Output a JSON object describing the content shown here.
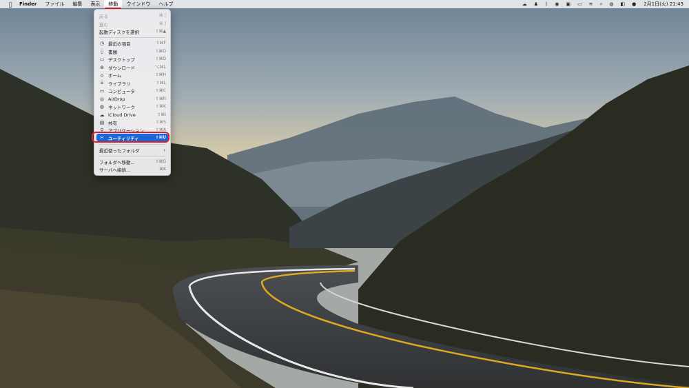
{
  "menubar": {
    "apple_icon": "apple-icon",
    "app_name": "Finder",
    "items": [
      "ファイル",
      "編集",
      "表示",
      "移動",
      "ウインドウ",
      "ヘルプ"
    ],
    "active_item": "移動",
    "status_icons": [
      "cloud-icon",
      "person-icon",
      "bluetooth-icon",
      "record-icon",
      "keyboard-icon",
      "wifi-icon",
      "search-icon",
      "user-icon",
      "control-center-icon",
      "siri-icon"
    ],
    "clock": "2月1日(火) 21:43"
  },
  "go_menu": {
    "items": [
      {
        "label": "戻る",
        "shortcut": "⌘ [",
        "disabled": true
      },
      {
        "label": "進む",
        "shortcut": "⌘ ]",
        "disabled": true
      },
      {
        "label": "起動ディスクを選択",
        "shortcut": "⇧⌘▲"
      },
      {
        "label": "最近の項目",
        "shortcut": "⇧⌘F",
        "icon": "clock-icon"
      },
      {
        "label": "書類",
        "shortcut": "⇧⌘O",
        "icon": "document-icon"
      },
      {
        "label": "デスクトップ",
        "shortcut": "⇧⌘D",
        "icon": "desktop-icon"
      },
      {
        "label": "ダウンロード",
        "shortcut": "⌥⌘L",
        "icon": "download-icon"
      },
      {
        "label": "ホーム",
        "shortcut": "⇧⌘H",
        "icon": "home-icon"
      },
      {
        "label": "ライブラリ",
        "shortcut": "⇧⌘L",
        "icon": "library-icon"
      },
      {
        "label": "コンピュータ",
        "shortcut": "⇧⌘C",
        "icon": "computer-icon"
      },
      {
        "label": "AirDrop",
        "shortcut": "⇧⌘R",
        "icon": "airdrop-icon"
      },
      {
        "label": "ネットワーク",
        "shortcut": "⇧⌘K",
        "icon": "network-icon"
      },
      {
        "label": "iCloud Drive",
        "shortcut": "⇧⌘I",
        "icon": "cloud-icon"
      },
      {
        "label": "共有",
        "shortcut": "⇧⌘S",
        "icon": "shared-folder-icon"
      },
      {
        "label": "アプリケーション",
        "shortcut": "⇧⌘A",
        "icon": "applications-icon"
      },
      {
        "label": "ユーティリティ",
        "shortcut": "⇧⌘U",
        "icon": "utilities-icon",
        "selected": true
      },
      {
        "label": "最近使ったフォルダ"
      },
      {
        "label": "フォルダへ移動...",
        "shortcut": "⇧⌘G"
      },
      {
        "label": "サーバへ接続...",
        "shortcut": "⌘K"
      }
    ]
  },
  "colors": {
    "selection": "#1a66d6",
    "annotation_red": "#e0202a"
  }
}
